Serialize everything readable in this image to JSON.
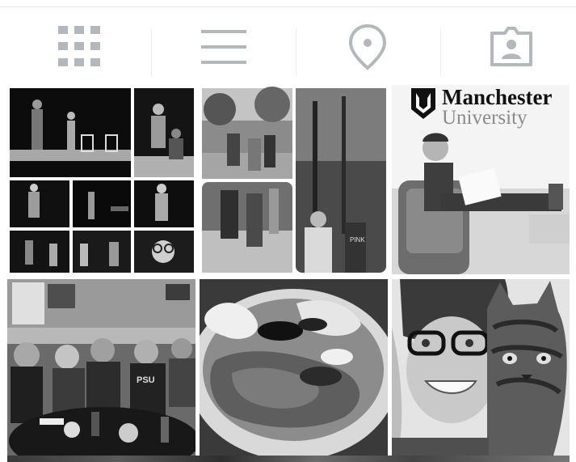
{
  "tabs": [
    {
      "name": "grid-view",
      "icon": "grid-icon",
      "selected": true
    },
    {
      "name": "list-view",
      "icon": "list-icon",
      "selected": false
    },
    {
      "name": "map-view",
      "icon": "location-pin-icon",
      "selected": false
    },
    {
      "name": "tagged-view",
      "icon": "tagged-user-icon",
      "selected": false
    }
  ],
  "colors": {
    "icon": "#b3b8bd",
    "separator": "#ececec"
  },
  "posts": {
    "manchester_logo": {
      "line1": "Manchester",
      "line2": "University"
    }
  }
}
